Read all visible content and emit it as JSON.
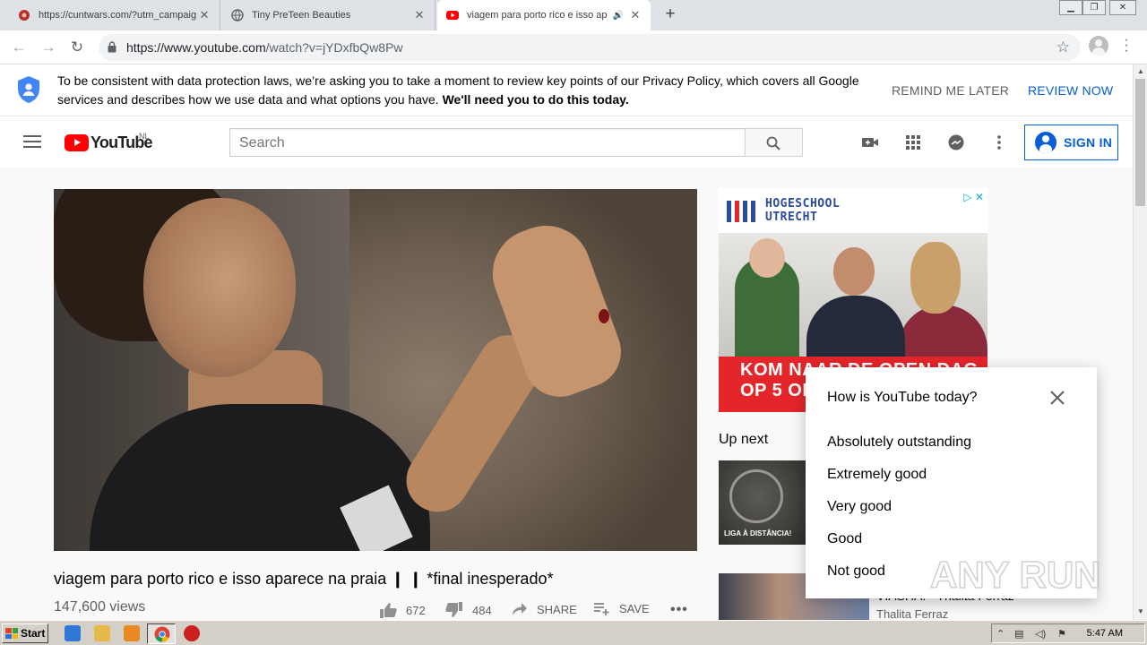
{
  "browser": {
    "tabs": [
      {
        "title": "https://cuntwars.com/?utm_campaig",
        "active": false
      },
      {
        "title": "Tiny PreTeen Beauties",
        "active": false
      },
      {
        "title": "viagem para porto rico e isso ap",
        "active": true
      }
    ],
    "url_host": "https://www.youtube.com",
    "url_path": "/watch?v=jYDxfbQw8Pw"
  },
  "consent": {
    "message": "To be consistent with data protection laws, we’re asking you to take a moment to review key points of our Privacy Policy, which covers all Google services and describes how we use data and what options you have.",
    "message_bold": "We'll need you to do this today.",
    "remind_label": "REMIND ME LATER",
    "review_label": "REVIEW NOW"
  },
  "masthead": {
    "logo_text": "YouTube",
    "country_code": "NL",
    "search_placeholder": "Search",
    "signin_label": "SIGN IN"
  },
  "video": {
    "title": "viagem para porto rico e isso aparece na praia ❙ ❙  *final inesperado*",
    "views": "147,600 views",
    "likes": "672",
    "dislikes": "484",
    "share_label": "SHARE",
    "save_label": "SAVE"
  },
  "ad": {
    "brand_line1": "HOGESCHOOL",
    "brand_line2": "UTRECHT",
    "headline_line1": "KOM NAAR DE OPEN DAG",
    "headline_line2": "OP 5 OKT"
  },
  "sidebar": {
    "up_next_label": "Up next",
    "thumb1_caption": "LIGA À DISTÂNCIA!",
    "item2_title_partial": "VIASHA! - Thalita Ferraz",
    "item2_channel": "Thalita Ferraz"
  },
  "survey": {
    "question": "How is YouTube today?",
    "options": [
      "Absolutely outstanding",
      "Extremely good",
      "Very good",
      "Good",
      "Not good"
    ]
  },
  "watermark": "ANY RUN",
  "taskbar": {
    "start_label": "Start",
    "clock": "5:47 AM"
  },
  "colors": {
    "youtube_red": "#ff0000",
    "link_blue": "#065fd4",
    "ad_red": "#e4262b"
  }
}
